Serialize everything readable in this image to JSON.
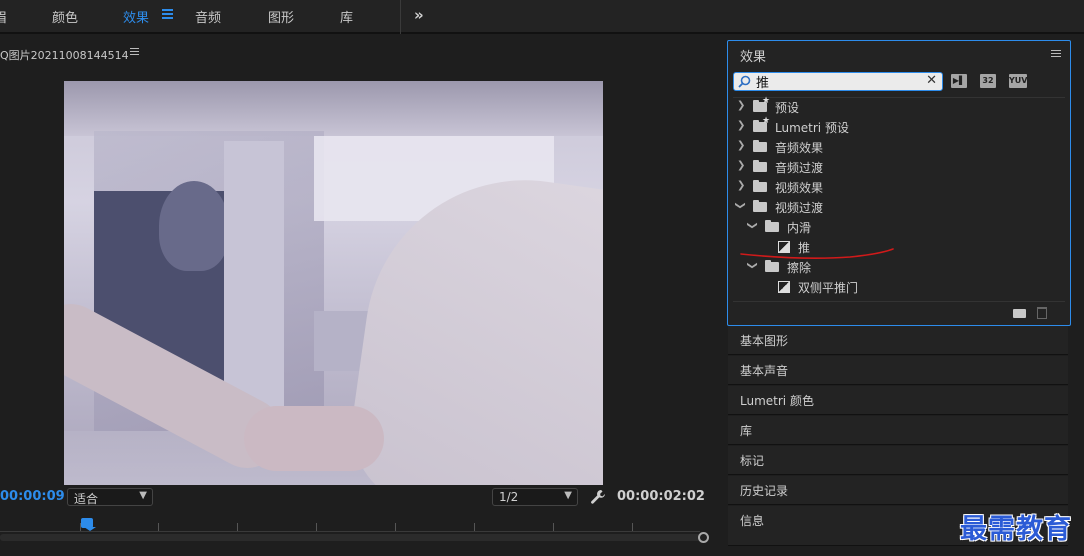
{
  "workspace": {
    "tabs": [
      {
        "label": "眉"
      },
      {
        "label": "颜色"
      },
      {
        "label": "效果"
      },
      {
        "label": "音频"
      },
      {
        "label": "图形"
      },
      {
        "label": "库"
      }
    ],
    "active_tab": "效果",
    "more_label": "»"
  },
  "monitor": {
    "title": "Q图片20211008144514",
    "timecode_current": "00:00:09",
    "fit_select": "适合",
    "resolution_select": "1/2",
    "timecode_duration": "00:00:02:02"
  },
  "effects_panel": {
    "title": "效果",
    "search_value": "推",
    "badges": [
      "32",
      "YUV"
    ],
    "tree": [
      {
        "label": "预设",
        "type": "preset-folder",
        "level": 0,
        "expanded": false
      },
      {
        "label": "Lumetri 预设",
        "type": "preset-folder",
        "level": 0,
        "expanded": false
      },
      {
        "label": "音频效果",
        "type": "folder",
        "level": 0,
        "expanded": false
      },
      {
        "label": "音频过渡",
        "type": "folder",
        "level": 0,
        "expanded": false
      },
      {
        "label": "视频效果",
        "type": "folder",
        "level": 0,
        "expanded": false
      },
      {
        "label": "视频过渡",
        "type": "folder",
        "level": 0,
        "expanded": true
      },
      {
        "label": "内滑",
        "type": "folder",
        "level": 1,
        "expanded": true
      },
      {
        "label": "推",
        "type": "effect",
        "level": 2
      },
      {
        "label": "擦除",
        "type": "folder",
        "level": 1,
        "expanded": true
      },
      {
        "label": "双侧平推门",
        "type": "effect",
        "level": 2
      }
    ]
  },
  "sections": [
    {
      "label": "基本图形"
    },
    {
      "label": "基本声音"
    },
    {
      "label": "Lumetri 颜色"
    },
    {
      "label": "库"
    },
    {
      "label": "标记"
    },
    {
      "label": "历史记录"
    },
    {
      "label": "信息"
    }
  ],
  "watermark": "最需教育",
  "colors": {
    "accent": "#2d8ceb",
    "annotation": "#d11a1a",
    "watermark": "#2b5bd6"
  }
}
